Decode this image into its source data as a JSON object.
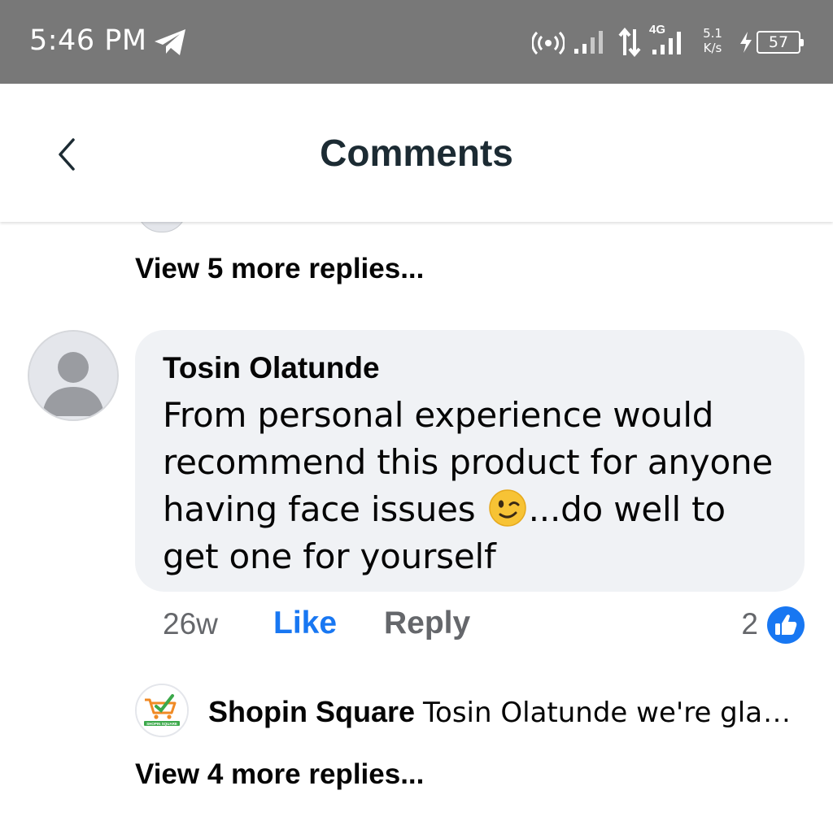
{
  "status_bar": {
    "time": "5:46 PM",
    "network_type": "4G",
    "net_speed_value": "5.1",
    "net_speed_unit": "K/s",
    "battery_level": "57",
    "icons": [
      "telegram-icon",
      "hotspot-icon",
      "signal-icon",
      "data-arrows-icon",
      "signal-4g-icon",
      "charging-icon",
      "battery-icon"
    ]
  },
  "header": {
    "title": "Comments",
    "back_icon": "chevron-left-icon"
  },
  "comments": {
    "view_more_top": "View 5 more replies...",
    "main": {
      "author": "Tosin Olatunde",
      "text_before_emoji": "From personal experience would recommend this product for anyone having face issues ",
      "emoji": "winking-face",
      "text_after_emoji": "...do well to get one for yourself",
      "time": "26w",
      "like_label": "Like",
      "reply_label": "Reply",
      "reaction_count": "2",
      "reaction_icon": "like-reaction-icon"
    },
    "reply": {
      "author": "Shopin Square",
      "snippet": "Tosin Olatunde we're glad...",
      "avatar_logo_text": "SHOPIN SQUARE"
    },
    "view_more_bottom": "View 4 more replies..."
  },
  "colors": {
    "status_bar_bg": "#787878",
    "bubble_bg": "#f0f2f5",
    "like_blue": "#1877f2",
    "secondary_text": "#65676b",
    "title_text": "#1c2b33"
  }
}
